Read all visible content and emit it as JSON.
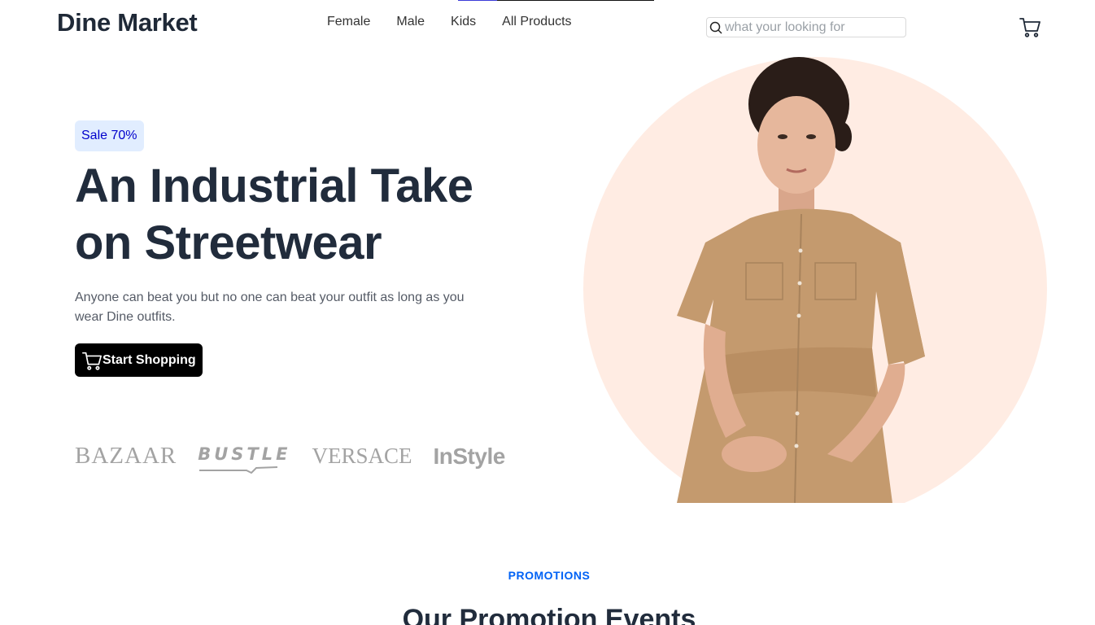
{
  "header": {
    "logo": "Dine Market",
    "nav": [
      "Female",
      "Male",
      "Kids",
      "All Products"
    ],
    "search": {
      "placeholder": "what your looking for",
      "icon": "search-icon"
    },
    "cart_icon": "cart-icon"
  },
  "hero": {
    "badge": "Sale 70%",
    "headline": "An Industrial Take on Streetwear",
    "tagline": "Anyone can beat you but no one can beat your outfit as long as you wear Dine outfits.",
    "cta_label": "Start Shopping",
    "brands": [
      "BAZAAR",
      "BUSTLE",
      "VERSACE",
      "InStyle"
    ],
    "circle_color": "#ffece3"
  },
  "promotions": {
    "eyebrow": "PROMOTIONS",
    "title": "Our Promotion Events"
  },
  "colors": {
    "accent": "#0062f5",
    "badge_bg": "#e1edff",
    "badge_text": "#0000cc",
    "cta_bg": "#000000",
    "heading": "#212c3c"
  }
}
